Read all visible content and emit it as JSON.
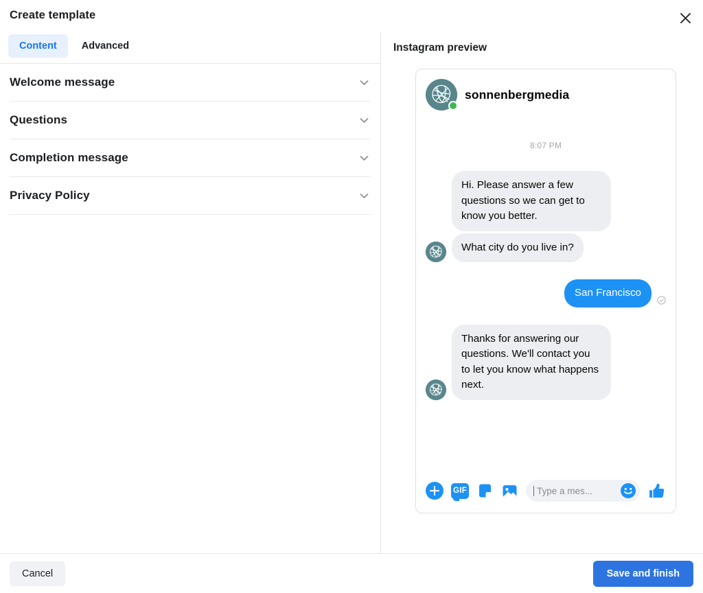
{
  "dialog": {
    "title": "Create template",
    "close_icon": "close-icon"
  },
  "tabs": [
    {
      "label": "Content",
      "active": true
    },
    {
      "label": "Advanced",
      "active": false
    }
  ],
  "accordion": {
    "sections": [
      {
        "label": "Welcome message",
        "icon": "chevron-down-icon"
      },
      {
        "label": "Questions",
        "icon": "chevron-down-icon"
      },
      {
        "label": "Completion message",
        "icon": "chevron-down-icon"
      },
      {
        "label": "Privacy Policy",
        "icon": "chevron-down-icon"
      }
    ]
  },
  "preview": {
    "title": "Instagram preview",
    "account_name": "sonnenbergmedia",
    "presence": "online",
    "timestamp": "8:07 PM",
    "messages": [
      {
        "from": "business",
        "text": "Hi. Please answer a few questions so we can get to know you better.",
        "show_avatar": false
      },
      {
        "from": "business",
        "text": "What city do you live in?",
        "show_avatar": true
      },
      {
        "from": "user",
        "text": "San Francisco",
        "status": "Delivered"
      },
      {
        "from": "business",
        "text": "Thanks for answering our questions. We'll contact you to let you know what happens next.",
        "show_avatar": true
      }
    ],
    "composer": {
      "placeholder": "Type a mes...",
      "gif_label": "GIF",
      "actions": [
        "add-icon",
        "gif-icon",
        "sticker-icon",
        "photo-icon",
        "emoji-icon",
        "like-icon"
      ]
    }
  },
  "footer": {
    "cancel_label": "Cancel",
    "save_label": "Save and finish"
  },
  "colors": {
    "accent_blue": "#1877f2",
    "primary_button": "#2d74e0",
    "bubble_out": "#1d92f5",
    "bubble_in": "#eceef1",
    "avatar_teal": "#58868c",
    "online_green": "#41b653",
    "tab_active_bg": "#e7f0fd"
  }
}
